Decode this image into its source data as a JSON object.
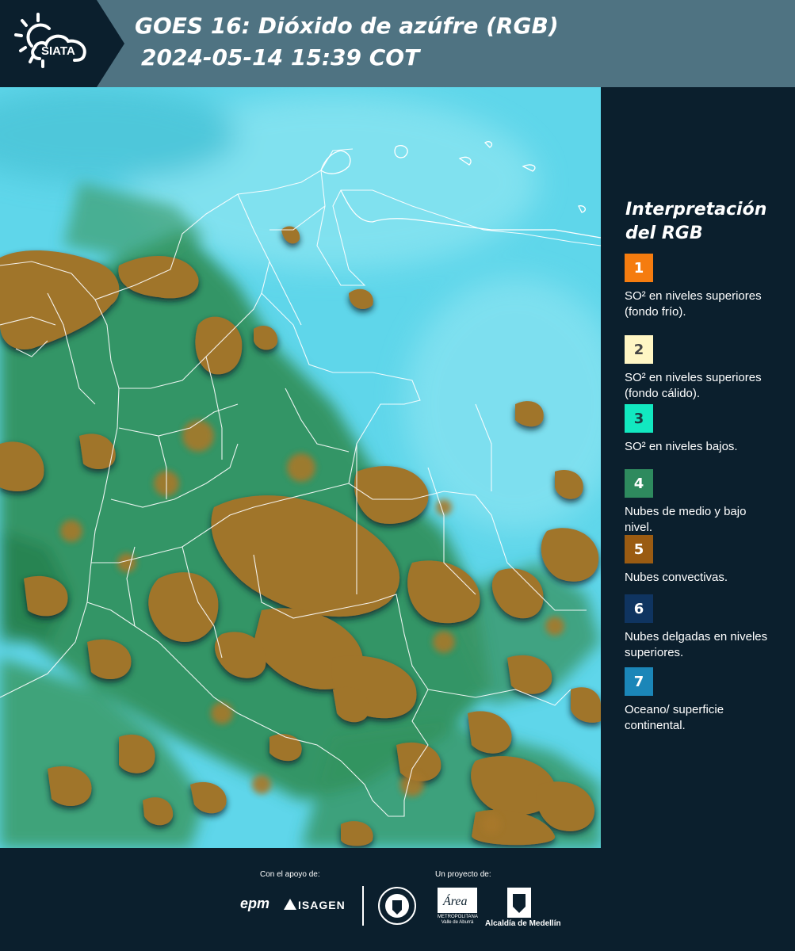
{
  "header": {
    "title_line1": "GOES 16: Dióxido de azúfre (RGB)",
    "title_line2": "2024-05-14 15:39 COT",
    "logo_text": "SIATA"
  },
  "legend": {
    "title_line1": "Interpretación",
    "title_line2": "del RGB",
    "items": [
      {
        "number": "1",
        "color": "#f57c0f",
        "text_color": "#ffffff",
        "label": "SO² en niveles superiores (fondo frío)."
      },
      {
        "number": "2",
        "color": "#fff6c4",
        "text_color": "#444444",
        "label": "SO² en niveles superiores (fondo cálido)."
      },
      {
        "number": "3",
        "color": "#12e8c0",
        "text_color": "#1a3a40",
        "label": "SO² en niveles bajos."
      },
      {
        "number": "4",
        "color": "#2e8a5e",
        "text_color": "#ffffff",
        "label": "Nubes de medio y bajo nivel."
      },
      {
        "number": "5",
        "color": "#9a5b12",
        "text_color": "#ffffff",
        "label": "Nubes convectivas."
      },
      {
        "number": "6",
        "color": "#0f3460",
        "text_color": "#ffffff",
        "label": "Nubes delgadas en niveles superiores."
      },
      {
        "number": "7",
        "color": "#1b86b8",
        "text_color": "#ffffff",
        "label": "Oceano/ superficie continental."
      }
    ]
  },
  "footer": {
    "support_label": "Con el apoyo de:",
    "project_label": "Un proyecto de:",
    "sponsor1": "epm",
    "sponsor2": "ISAGEN",
    "area_name": "Área",
    "area_sub": "METROPOLITANA Valle de Aburrá",
    "alcaldia": "Alcaldía de Medellín"
  },
  "colors": {
    "background": "#0b1f2d",
    "header": "#4f7382",
    "sky": "#5fd3e8",
    "convective": "#a0742a",
    "vegetation": "#2f8f55"
  }
}
